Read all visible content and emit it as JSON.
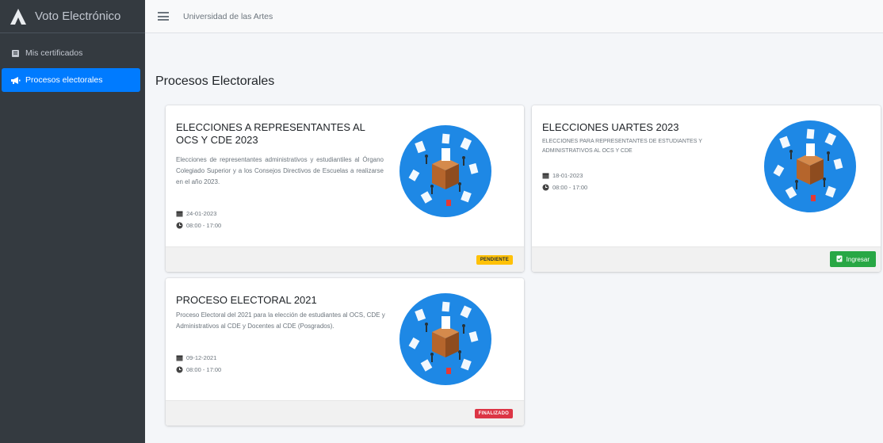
{
  "app": {
    "title": "Voto Electrónico"
  },
  "sidebar": {
    "items": [
      {
        "label": "Mis certificados",
        "icon": "certificate-icon",
        "active": false
      },
      {
        "label": "Procesos electorales",
        "icon": "bullhorn-icon",
        "active": true
      }
    ]
  },
  "topbar": {
    "org_name": "Universidad de las Artes"
  },
  "page": {
    "title": "Procesos Electorales"
  },
  "cards": [
    {
      "title": "ELECCIONES A REPRESENTANTES AL OCS Y CDE 2023",
      "description": "Elecciones de representantes administrativos y estudiantiles al Órgano Colegiado Superior y a los Consejos Directivos de Escuelas a realizarse en el año 2023.",
      "date": "24-01-2023",
      "time": "08:00 - 17:00",
      "status": "PENDIENTE",
      "status_color": "#ffc107"
    },
    {
      "title": "ELECCIONES UARTES 2023",
      "description": "ELECCIONES PARA REPRESENTANTES DE ESTUDIANTES Y ADMINISTRATIVOS AL OCS Y CDE",
      "date": "18-01-2023",
      "time": "08:00 - 17:00",
      "action_label": "Ingresar",
      "action_color": "#28a745"
    },
    {
      "title": "PROCESO ELECTORAL 2021",
      "description": "Proceso Electoral del 2021 para la elección de estudiantes al OCS, CDE y Administrativos al CDE y Docentes al CDE (Posgrados).",
      "date": "09-12-2021",
      "time": "08:00 - 17:00",
      "status": "FINALIZADO",
      "status_color": "#dc3545"
    }
  ],
  "colors": {
    "sidebar": "#343a40",
    "active": "#007bff",
    "illustration": "#1e88e5"
  }
}
